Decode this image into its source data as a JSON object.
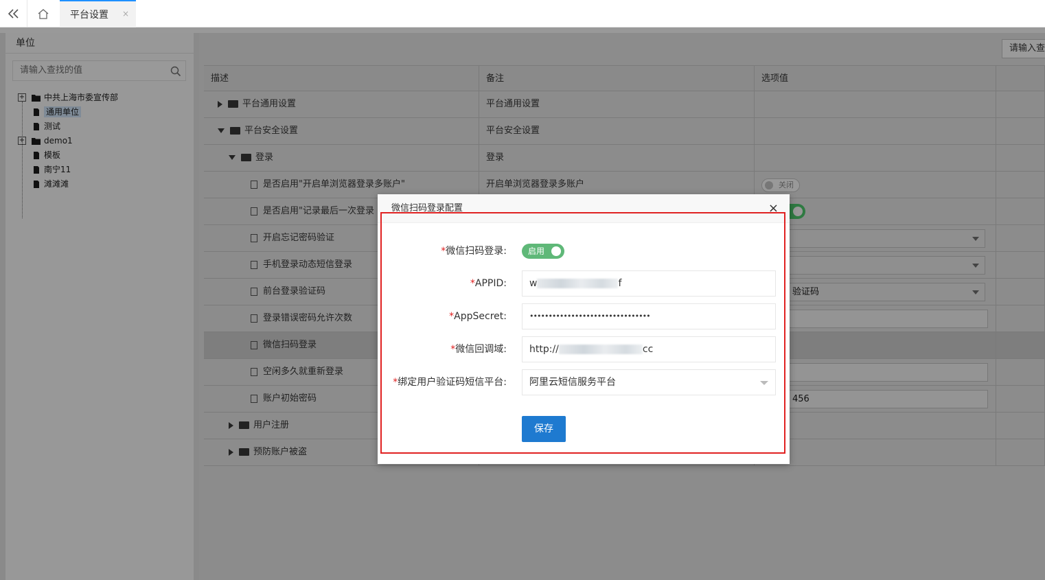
{
  "tabs": {
    "active_label": "平台设置",
    "close_glyph": "×"
  },
  "left_panel": {
    "title": "单位",
    "search_placeholder": "请输入查找的值",
    "tree": [
      {
        "label": "中共上海市委宣传部",
        "expandable": true,
        "icon": "folder-icon"
      },
      {
        "label": "通用单位",
        "selected": true,
        "icon": "file-icon"
      },
      {
        "label": "测试",
        "icon": "file-icon"
      },
      {
        "label": "demo1",
        "expandable": true,
        "icon": "folder-icon"
      },
      {
        "label": "模板",
        "icon": "file-icon"
      },
      {
        "label": "南宁11",
        "icon": "file-icon"
      },
      {
        "label": "滩滩滩",
        "icon": "file-icon"
      }
    ]
  },
  "right_panel": {
    "query_button": "请输入查",
    "columns": [
      "描述",
      "备注",
      "选项值"
    ],
    "rows": [
      {
        "desc": "平台通用设置",
        "note": "平台通用设置",
        "type": "folder-collapsed"
      },
      {
        "desc": "平台安全设置",
        "note": "平台安全设置",
        "type": "folder-expanded"
      },
      {
        "desc": "登录",
        "note": "登录",
        "type": "folder-expanded"
      },
      {
        "desc": "是否启用\"开启单浏览器登录多账户\"",
        "note": "开启单浏览器登录多账户",
        "value": "关闭"
      },
      {
        "desc": "是否启用\"记录最后一次登录",
        "note": "",
        "value": ""
      },
      {
        "desc": "开启忘记密码验证",
        "note": "",
        "value": ""
      },
      {
        "desc": "手机登录动态短信登录",
        "note": "",
        "value": ""
      },
      {
        "desc": "前台登录验证码",
        "note": "",
        "value": "验证码"
      },
      {
        "desc": "登录错误密码允许次数",
        "note": "",
        "value": ""
      },
      {
        "desc": "微信扫码登录",
        "note": "",
        "value": ""
      },
      {
        "desc": "空闲多久就重新登录",
        "note": "",
        "value": ""
      },
      {
        "desc": "账户初始密码",
        "note": "",
        "value": "456"
      },
      {
        "desc": "用户注册",
        "note": "",
        "type": "folder-collapsed"
      },
      {
        "desc": "预防账户被盗",
        "note": "",
        "type": "folder-collapsed"
      }
    ]
  },
  "modal": {
    "title": "微信扫码登录配置",
    "close": "×",
    "fields": {
      "wechat_login": {
        "label": "微信扫码登录:",
        "value": "启用"
      },
      "appid": {
        "label": "APPID:",
        "value_start": "w",
        "value_end": "f"
      },
      "appsecret": {
        "label": "AppSecret:",
        "value": "••••••••••••••••••••••••••••••••"
      },
      "callback": {
        "label": "微信回调域:",
        "value_start": "http://",
        "value_end": "cc"
      },
      "sms_platform": {
        "label": "绑定用户验证码短信平台:",
        "value": "阿里云短信服务平台"
      }
    },
    "required_mark": "*",
    "save_label": "保存"
  }
}
